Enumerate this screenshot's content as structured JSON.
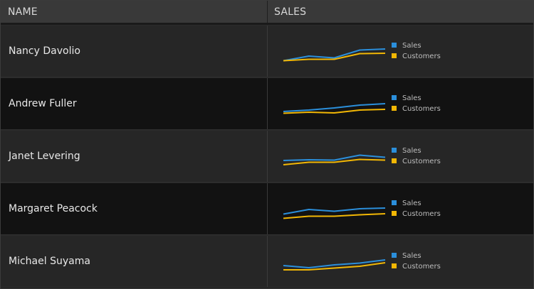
{
  "header": {
    "name_label": "NAME",
    "sales_label": "SALES"
  },
  "colors": {
    "sales": "#2b8fdb",
    "customers": "#f2b705"
  },
  "rows": [
    {
      "name": "Nancy Davolio",
      "chart_data": {
        "type": "line",
        "series": [
          {
            "name": "Sales",
            "values": [
              25,
              38,
              33,
              55,
              58
            ]
          },
          {
            "name": "Customers",
            "values": [
              25,
              29,
              29,
              45,
              46
            ]
          }
        ],
        "ylim": [
          0,
          100
        ]
      }
    },
    {
      "name": "Andrew Fuller",
      "chart_data": {
        "type": "line",
        "series": [
          {
            "name": "Sales",
            "values": [
              30,
              34,
              40,
              48,
              52
            ]
          },
          {
            "name": "Customers",
            "values": [
              25,
              28,
              26,
              34,
              36
            ]
          }
        ],
        "ylim": [
          0,
          100
        ]
      }
    },
    {
      "name": "Janet Levering",
      "chart_data": {
        "type": "line",
        "series": [
          {
            "name": "Sales",
            "values": [
              40,
              42,
              41,
              55,
              49
            ]
          },
          {
            "name": "Customers",
            "values": [
              28,
              35,
              35,
              43,
              41
            ]
          }
        ],
        "ylim": [
          0,
          100
        ]
      }
    },
    {
      "name": "Margaret Peacock",
      "chart_data": {
        "type": "line",
        "series": [
          {
            "name": "Sales",
            "values": [
              37,
              50,
              45,
              52,
              54
            ]
          },
          {
            "name": "Customers",
            "values": [
              25,
              31,
              31,
              35,
              38
            ]
          }
        ],
        "ylim": [
          0,
          100
        ]
      }
    },
    {
      "name": "Michael Suyama",
      "chart_data": {
        "type": "line",
        "series": [
          {
            "name": "Sales",
            "values": [
              40,
              34,
              42,
              47,
              56
            ]
          },
          {
            "name": "Customers",
            "values": [
              28,
              28,
              33,
              38,
              48
            ]
          }
        ],
        "ylim": [
          0,
          100
        ]
      }
    }
  ],
  "legend": {
    "sales": "Sales",
    "customers": "Customers"
  }
}
